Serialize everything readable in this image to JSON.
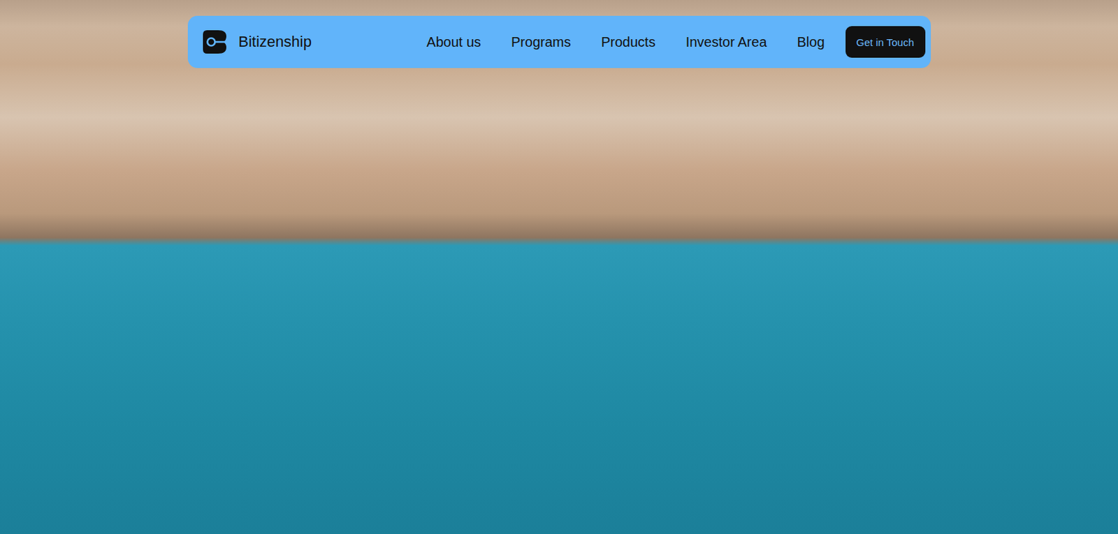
{
  "brand": {
    "name": "Bitizenship"
  },
  "nav": {
    "items": [
      "About us",
      "Programs",
      "Products",
      "Investor Area",
      "Blog"
    ]
  },
  "cta": {
    "label": "Get in Touch"
  }
}
